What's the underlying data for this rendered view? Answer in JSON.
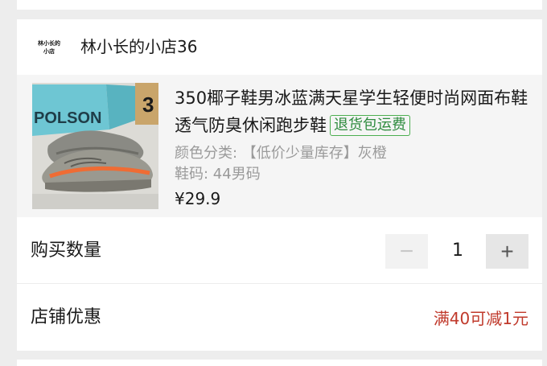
{
  "store": {
    "logo_line1": "林小长的",
    "logo_line2": "小店",
    "name": "林小长的小店36"
  },
  "product": {
    "image_icon": "sneaker-photo",
    "box_text": "POLSON",
    "box_number": "3",
    "title": "350椰子鞋男冰蓝满天星学生轻便时尚网面布鞋透气防臭休闲跑步鞋",
    "return_tag": "退货包运费",
    "spec": "颜色分类: 【低价少量库存】灰橙",
    "size": "鞋码: 44男码",
    "price": "¥29.9"
  },
  "quantity": {
    "label": "购买数量",
    "minus": "−",
    "value": "1",
    "plus": "+"
  },
  "discount": {
    "label": "店铺优惠",
    "value": "满40可减1元"
  },
  "colors": {
    "accent_red": "#c0392b",
    "tag_green": "#2e8b3e",
    "muted_gray": "#9a9a9a"
  }
}
